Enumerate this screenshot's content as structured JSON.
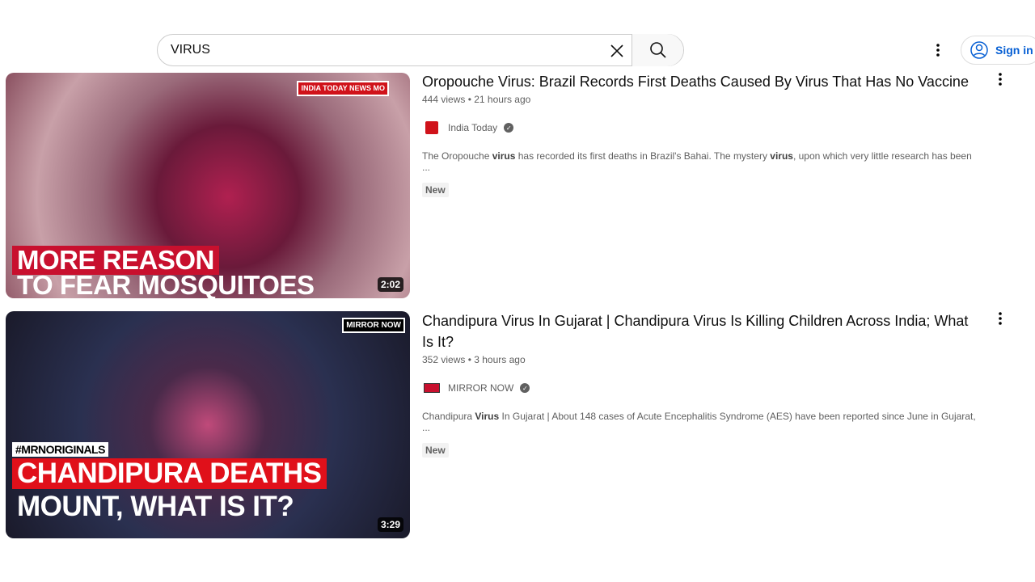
{
  "search": {
    "value": "VIRUS"
  },
  "header": {
    "sign_in": "Sign in"
  },
  "results": [
    {
      "title": "Oropouche Virus: Brazil Records First Deaths Caused By Virus That Has No Vaccine",
      "views": "444 views",
      "age": "21 hours ago",
      "channel": "India Today",
      "desc_parts": [
        "The Oropouche ",
        "virus",
        " has recorded its first deaths in Brazil's Bahai. The mystery ",
        "virus",
        ", upon which very little research has been ..."
      ],
      "badge": "New",
      "duration": "2:02",
      "thumb_caption": [
        "MORE REASON",
        "TO FEAR MOSQUITOES"
      ],
      "thumb_logo": "INDIA TODAY NEWS MO"
    },
    {
      "title": "Chandipura Virus In Gujarat | Chandipura Virus Is Killing Children Across India; What Is It?",
      "views": "352 views",
      "age": "3 hours ago",
      "channel": "MIRROR NOW",
      "desc_parts": [
        "Chandipura ",
        "Virus",
        " In Gujarat | About 148 cases of Acute Encephalitis Syndrome (AES) have been reported since June in Gujarat, ..."
      ],
      "badge": "New",
      "duration": "3:29",
      "thumb_caption": [
        "#MRNORIGINALS",
        "CHANDIPURA DEATHS",
        "MOUNT, WHAT IS IT?"
      ],
      "thumb_logo": "MIRROR NOW"
    }
  ],
  "colors": {
    "accent": "#065fd4",
    "caption_red": "#c8102e"
  }
}
